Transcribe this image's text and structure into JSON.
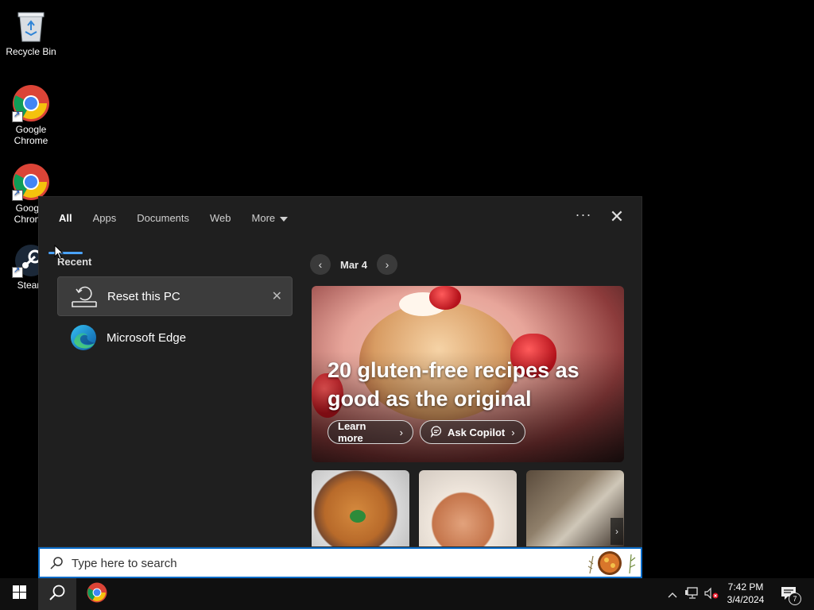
{
  "desktop": {
    "icons": [
      {
        "label": "Recycle Bin",
        "icon": "recycle-bin-icon"
      },
      {
        "label": "Google Chrome",
        "icon": "chrome-icon"
      },
      {
        "label": "Google Chrome",
        "icon": "chrome-icon"
      },
      {
        "label": "Steam",
        "icon": "steam-icon"
      }
    ]
  },
  "search_panel": {
    "tabs": [
      {
        "label": "All",
        "active": true
      },
      {
        "label": "Apps"
      },
      {
        "label": "Documents"
      },
      {
        "label": "Web"
      },
      {
        "label": "More"
      }
    ],
    "options_icon": "ellipsis-icon",
    "close_icon": "close-icon",
    "recent": {
      "heading": "Recent",
      "items": [
        {
          "label": "Reset this PC",
          "icon": "reset-pc-icon",
          "selected": true
        },
        {
          "label": "Microsoft Edge",
          "icon": "edge-icon"
        }
      ]
    },
    "highlights": {
      "date": "Mar 4",
      "hero_title": "20 gluten-free recipes as good as the original",
      "learn_more": "Learn more",
      "ask_copilot": "Ask Copilot"
    }
  },
  "search_bar": {
    "placeholder": "Type here to search"
  },
  "taskbar": {
    "start_icon": "windows-start-icon",
    "search_icon": "search-icon",
    "pinned": [
      "chrome-icon"
    ],
    "tray_icons": [
      "chevron-up-icon",
      "network-icon",
      "volume-muted-icon"
    ],
    "time": "7:42 PM",
    "date": "3/4/2024",
    "notifications_count": "7"
  },
  "colors": {
    "accent": "#4aa3ff",
    "search_border": "#0a6cc9",
    "panel_bg": "#1f1f1f"
  }
}
